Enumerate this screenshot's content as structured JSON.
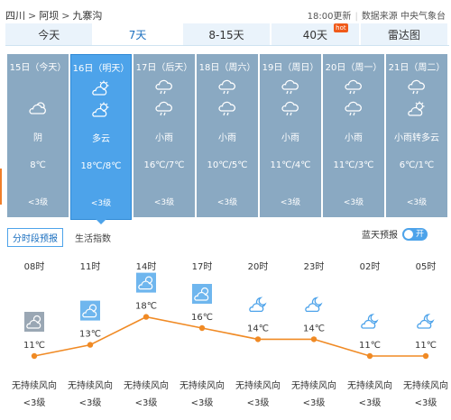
{
  "breadcrumb": [
    "四川",
    "阿坝",
    "九寨沟"
  ],
  "top_right": {
    "update_time": "18:00更新",
    "source": "数据来源 中央气象台"
  },
  "tabs": [
    {
      "label": "今天",
      "active": false
    },
    {
      "label": "7天",
      "active": true
    },
    {
      "label": "8-15天",
      "active": false
    },
    {
      "label": "40天",
      "active": false,
      "badge": "hot"
    },
    {
      "label": "雷达图",
      "active": false
    }
  ],
  "days": [
    {
      "date": "15日（今天）",
      "cond": "阴",
      "temp": "8℃",
      "wind": "<3级",
      "icons": [
        "",
        "overcast-icon"
      ]
    },
    {
      "date": "16日（明天）",
      "cond": "多云",
      "temp": "18℃/8℃",
      "wind": "<3级",
      "icons": [
        "partly-cloudy-icon",
        "partly-cloudy-icon"
      ]
    },
    {
      "date": "17日（后天）",
      "cond": "小雨",
      "temp": "16℃/7℃",
      "wind": "<3级",
      "icons": [
        "rain-icon",
        "rain-icon"
      ]
    },
    {
      "date": "18日（周六）",
      "cond": "小雨",
      "temp": "10℃/5℃",
      "wind": "<3级",
      "icons": [
        "rain-icon",
        "rain-icon"
      ]
    },
    {
      "date": "19日（周日）",
      "cond": "小雨",
      "temp": "11℃/4℃",
      "wind": "<3级",
      "icons": [
        "rain-icon",
        "rain-icon"
      ]
    },
    {
      "date": "20日（周一）",
      "cond": "小雨",
      "temp": "11℃/3℃",
      "wind": "<3级",
      "icons": [
        "rain-icon",
        "rain-icon"
      ]
    },
    {
      "date": "21日（周二）",
      "cond": "小雨转多云",
      "temp": "6℃/1℃",
      "wind": "<3级",
      "icons": [
        "rain-icon",
        "partly-cloudy-icon"
      ]
    }
  ],
  "subtabs": {
    "active": "分时段预报",
    "other": "生活指数"
  },
  "bluesky": {
    "label": "蓝天预报",
    "toggle": "开"
  },
  "chart_data": {
    "type": "line",
    "x": [
      "08时",
      "11时",
      "14时",
      "17时",
      "20时",
      "23时",
      "02时",
      "05时"
    ],
    "values": [
      11,
      13,
      18,
      16,
      14,
      14,
      11,
      11
    ],
    "value_labels": [
      "11℃",
      "13℃",
      "18℃",
      "16℃",
      "14℃",
      "14℃",
      "11℃",
      "11℃"
    ],
    "icons": [
      "overcast-icon",
      "partly-cloudy-icon",
      "partly-cloudy-icon",
      "partly-cloudy-icon",
      "partly-cloudy-night-icon",
      "partly-cloudy-night-icon",
      "partly-cloudy-night-icon",
      "partly-cloudy-night-icon"
    ],
    "wind_dir": [
      "无持续风向",
      "无持续风向",
      "无持续风向",
      "无持续风向",
      "无持续风向",
      "无持续风向",
      "无持续风向",
      "无持续风向"
    ],
    "wind_level": [
      "<3级",
      "<3级",
      "<3级",
      "<3级",
      "<3级",
      "<3级",
      "<3级",
      "<3级"
    ],
    "line_color": "#f08a24"
  }
}
